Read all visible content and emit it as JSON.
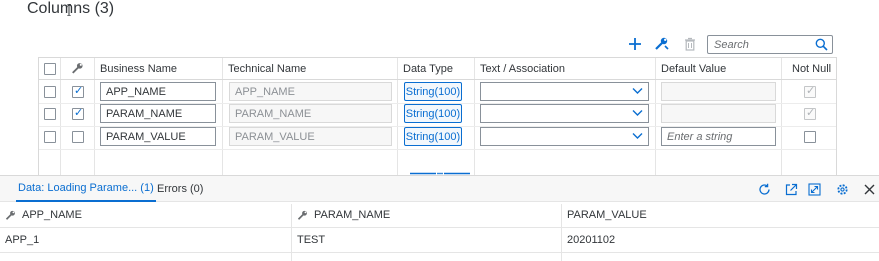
{
  "title": "Columns (3)",
  "toolbar": {
    "add_icon": "plus-icon",
    "edit_icon": "wrench-icon",
    "delete_icon": "trash-icon",
    "search_placeholder": "Search",
    "search_icon": "search-icon"
  },
  "columns_table": {
    "headers": [
      "Business Name",
      "Technical Name",
      "Data Type",
      "Text / Association",
      "Default Value",
      "Not Null"
    ],
    "key_header_icon": "wrench-icon",
    "rows": [
      {
        "selected": false,
        "key": true,
        "business_name": "APP_NAME",
        "technical_name": "APP_NAME",
        "data_type": "String(100)",
        "association": "",
        "default_value": "",
        "default_placeholder": "",
        "not_null": true,
        "not_null_disabled": true
      },
      {
        "selected": false,
        "key": true,
        "business_name": "PARAM_NAME",
        "technical_name": "PARAM_NAME",
        "data_type": "String(100)",
        "association": "",
        "default_value": "",
        "default_placeholder": "",
        "not_null": true,
        "not_null_disabled": true
      },
      {
        "selected": false,
        "key": false,
        "business_name": "PARAM_VALUE",
        "technical_name": "PARAM_VALUE",
        "data_type": "String(100)",
        "association": "",
        "default_value": "",
        "default_placeholder": "Enter a string",
        "not_null": false,
        "not_null_disabled": false
      }
    ]
  },
  "bottom_panel": {
    "tabs": [
      {
        "label": "Data: Loading Parame... (1)",
        "active": true
      },
      {
        "label": "Errors (0)",
        "active": false
      }
    ],
    "icons": [
      "refresh-icon",
      "export-icon",
      "fullscreen-icon",
      "settings-icon",
      "close-icon"
    ],
    "result_headers": [
      "APP_NAME",
      "PARAM_NAME",
      "PARAM_VALUE"
    ],
    "result_rows": [
      [
        "APP_1",
        "TEST",
        "20201102"
      ]
    ]
  },
  "colors": {
    "accent": "#0a6ed1",
    "text": "#32363a",
    "border": "#d9d9d9"
  }
}
